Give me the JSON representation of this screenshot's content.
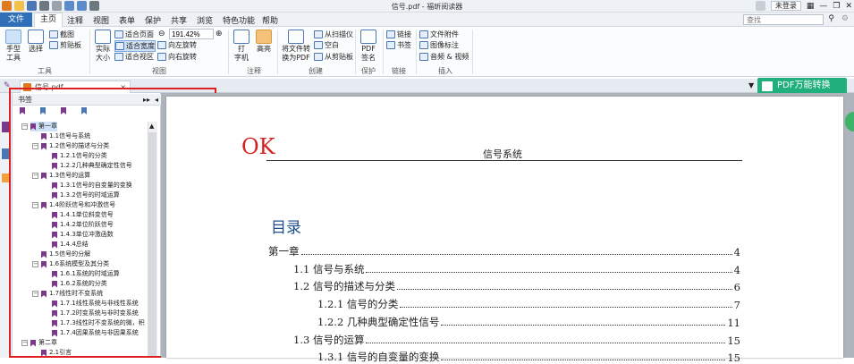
{
  "window": {
    "title": "信号.pdf - 福昕阅读器",
    "login": "未登录"
  },
  "menu": {
    "items": [
      "文件",
      "主页",
      "注释",
      "视图",
      "表单",
      "保护",
      "共享",
      "浏览",
      "特色功能",
      "帮助"
    ],
    "search_placeholder": "查找"
  },
  "ribbon": {
    "hand_tool": "手型\n工具",
    "select": "选择",
    "screenshot": "截图",
    "clipboard": "剪贴板",
    "actual_size": "实际\n大小",
    "fit_page": "适合页面",
    "fit_width": "适合宽度",
    "fit_view": "适合视区",
    "zoom_value": "191.42%",
    "rotate_left": "向左旋转",
    "rotate_right": "向右旋转",
    "typewriter": "打\n字机",
    "highlight": "高亮",
    "convert_pdf": "将文件转\n换为PDF",
    "from_scanner": "从扫描仪",
    "blank": "空白",
    "from_clipboard": "从剪贴板",
    "pdf_sign": "PDF\n签名",
    "link": "链接",
    "bookmark": "书签",
    "file_attachment": "文件附件",
    "image_annotation": "图像标注",
    "audio_video": "音频 & 视频",
    "groups": [
      "工具",
      "视图",
      "注释",
      "创建",
      "保护",
      "链接",
      "插入"
    ]
  },
  "tab": {
    "name": "信号.pdf",
    "promo": "PDF万能转换"
  },
  "panel": {
    "title": "书签"
  },
  "bookmarks": [
    {
      "label": "第一章",
      "level": 0
    },
    {
      "label": "1.1信号与系统",
      "level": 1
    },
    {
      "label": "1.2信号的描述与分类",
      "level": 1
    },
    {
      "label": "1.2.1信号的分类",
      "level": 2
    },
    {
      "label": "1.2.2几种典型确定性信号",
      "level": 2
    },
    {
      "label": "1.3信号的运算",
      "level": 1
    },
    {
      "label": "1.3.1信号的自变量的变换",
      "level": 2
    },
    {
      "label": "1.3.2信号的时域运算",
      "level": 2
    },
    {
      "label": "1.4阶跃信号和冲激信号",
      "level": 1
    },
    {
      "label": "1.4.1单位斜变信号",
      "level": 2
    },
    {
      "label": "1.4.2单位阶跃信号",
      "level": 2
    },
    {
      "label": "1.4.3单位冲激函数",
      "level": 2
    },
    {
      "label": "1.4.4总结",
      "level": 2
    },
    {
      "label": "1.5信号的分解",
      "level": 1
    },
    {
      "label": "1.6系统模型及其分类",
      "level": 1
    },
    {
      "label": "1.6.1系统的时域运算",
      "level": 2
    },
    {
      "label": "1.6.2系统的分类",
      "level": 2
    },
    {
      "label": "1.7线性时不变系统",
      "level": 1
    },
    {
      "label": "1.7.1线性系统与非线性系统",
      "level": 2
    },
    {
      "label": "1.7.2时变系统与非时变系统",
      "level": 2
    },
    {
      "label": "1.7.3线性时不变系统的微，积",
      "level": 2
    },
    {
      "label": "1.7.4因果系统与非因果系统",
      "level": 2
    },
    {
      "label": "第二章",
      "level": 0
    },
    {
      "label": "2.1引言",
      "level": 1
    }
  ],
  "document": {
    "stamp": "OK",
    "header": "信号系统",
    "toc_title": "目录",
    "toc": [
      {
        "title": "第一章",
        "page": "4"
      },
      {
        "title": "1.1 信号与系统",
        "page": "4"
      },
      {
        "title": "1.2 信号的描述与分类",
        "page": "6"
      },
      {
        "title": "1.2.1 信号的分类",
        "page": "7"
      },
      {
        "title": "1.2.2 几种典型确定性信号",
        "page": "11"
      },
      {
        "title": "1.3 信号的运算",
        "page": "15"
      },
      {
        "title": "1.3.1 信号的自变量的变换",
        "page": "15"
      }
    ]
  }
}
